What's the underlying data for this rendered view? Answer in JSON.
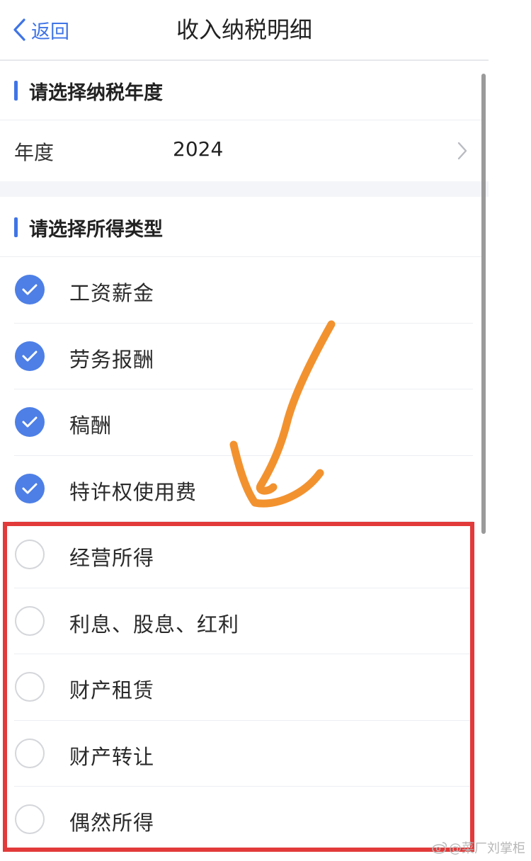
{
  "header": {
    "back_label": "返回",
    "title": "收入纳税明细"
  },
  "year_section": {
    "heading": "请选择纳税年度",
    "row_label": "年度",
    "row_value": "2024"
  },
  "type_section": {
    "heading": "请选择所得类型",
    "options": [
      {
        "label": "工资薪金",
        "checked": true
      },
      {
        "label": "劳务报酬",
        "checked": true
      },
      {
        "label": "稿酬",
        "checked": true
      },
      {
        "label": "特许权使用费",
        "checked": true
      },
      {
        "label": "经营所得",
        "checked": false
      },
      {
        "label": "利息、股息、红利",
        "checked": false
      },
      {
        "label": "财产租赁",
        "checked": false
      },
      {
        "label": "财产转让",
        "checked": false
      },
      {
        "label": "偶然所得",
        "checked": false
      }
    ]
  },
  "colors": {
    "accent": "#3f74e6",
    "checked_fill": "#4d7fe6",
    "highlight_box": "#e23a3a",
    "arrow": "#f2922f"
  },
  "watermark": {
    "text": "@菜厂刘掌柜"
  }
}
